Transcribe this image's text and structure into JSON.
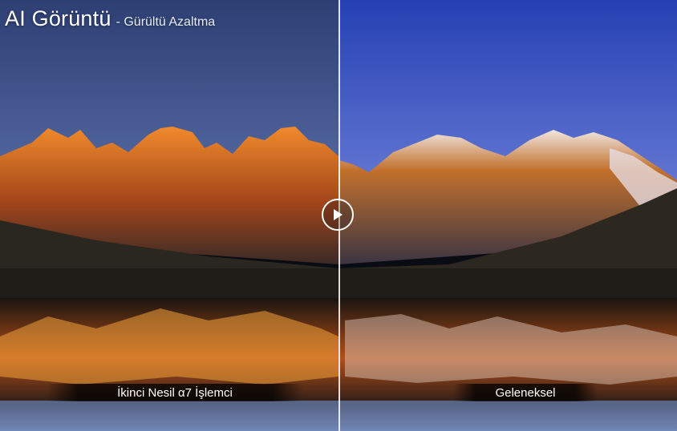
{
  "header": {
    "title": "AI Görüntü",
    "subtitle": "- Gürültü Azaltma"
  },
  "comparison": {
    "left_label": "İkinci Nesil α7 İşlemci",
    "right_label": "Geleneksel",
    "handle_icon": "play-icon"
  },
  "colors": {
    "sky_left": "#3a4f86",
    "sky_right": "#2f49b8",
    "mountain_glow": "#e0701f",
    "divider": "#ffffff"
  }
}
